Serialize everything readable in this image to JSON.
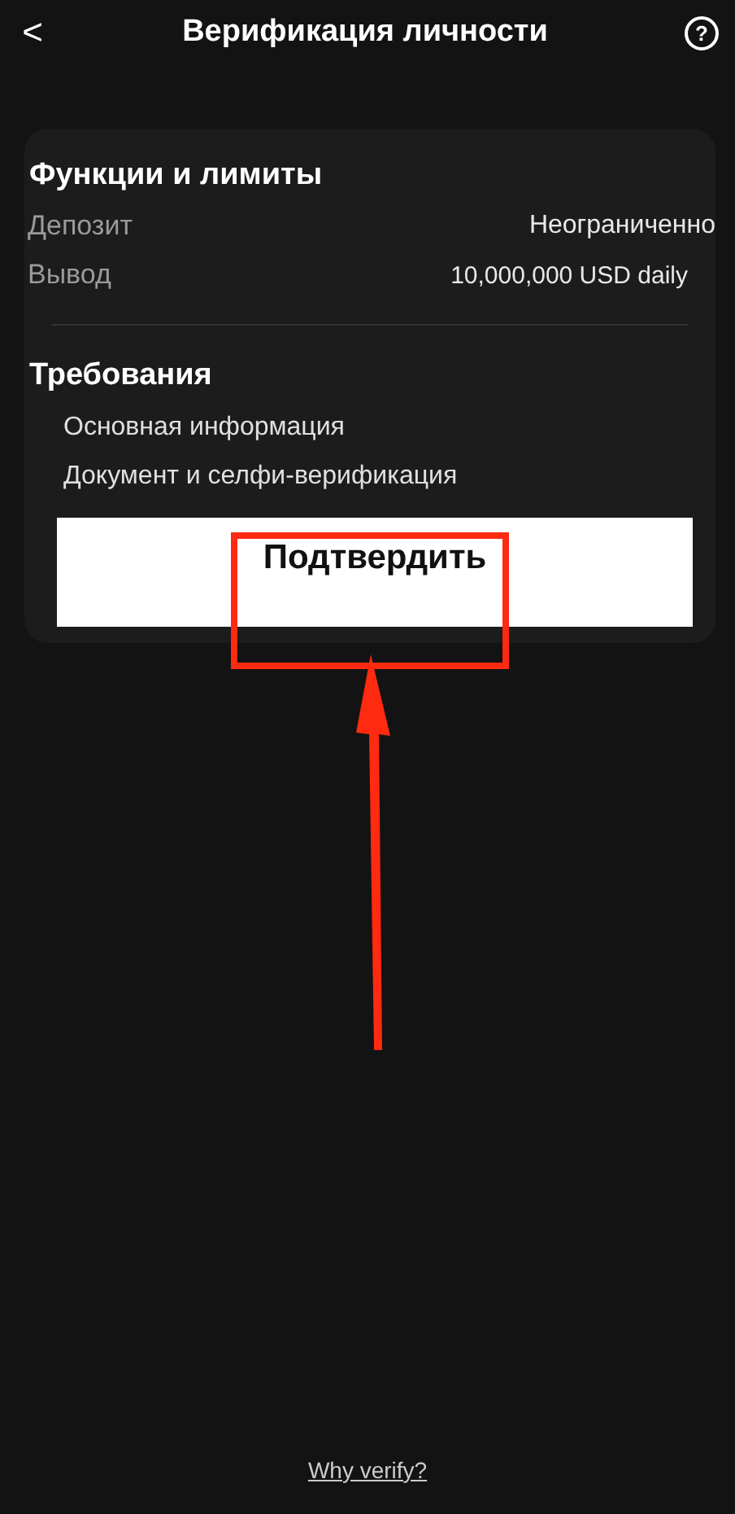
{
  "header": {
    "back": "<",
    "title": "Верификация личности",
    "help": "?"
  },
  "limits": {
    "title": "Функции и лимиты",
    "rows": [
      {
        "label": "Депозит",
        "value": "Неограниченно"
      },
      {
        "label": "Вывод",
        "value": "10,000,000 USD daily"
      }
    ]
  },
  "requirements": {
    "title": "Требования",
    "items": [
      "Основная информация",
      "Документ и селфи-верификация"
    ]
  },
  "confirm_button": {
    "label": "Подтвердить",
    "highlighted": true
  },
  "footer_link": "Why verify?"
}
